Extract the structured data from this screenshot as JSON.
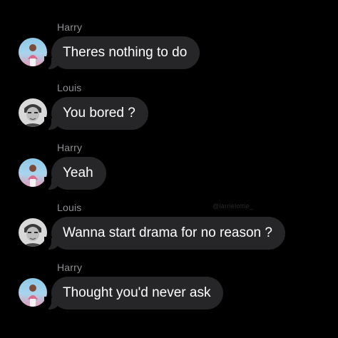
{
  "conversation": {
    "watermark": "@larrielottie_",
    "messages": [
      {
        "sender": "Harry",
        "avatar": "harry-avatar-icon",
        "text": "Theres nothing to do"
      },
      {
        "sender": "Louis",
        "avatar": "louis-avatar-icon",
        "text": "You bored ?"
      },
      {
        "sender": "Harry",
        "avatar": "harry-avatar-icon",
        "text": "Yeah"
      },
      {
        "sender": "Louis",
        "avatar": "louis-avatar-icon",
        "text": "Wanna start drama for no reason ?"
      },
      {
        "sender": "Harry",
        "avatar": "harry-avatar-icon",
        "text": "Thought you'd never ask"
      }
    ]
  },
  "colors": {
    "background": "#000000",
    "bubble": "#262628",
    "sender_name": "#8e8e93",
    "text": "#ffffff"
  }
}
